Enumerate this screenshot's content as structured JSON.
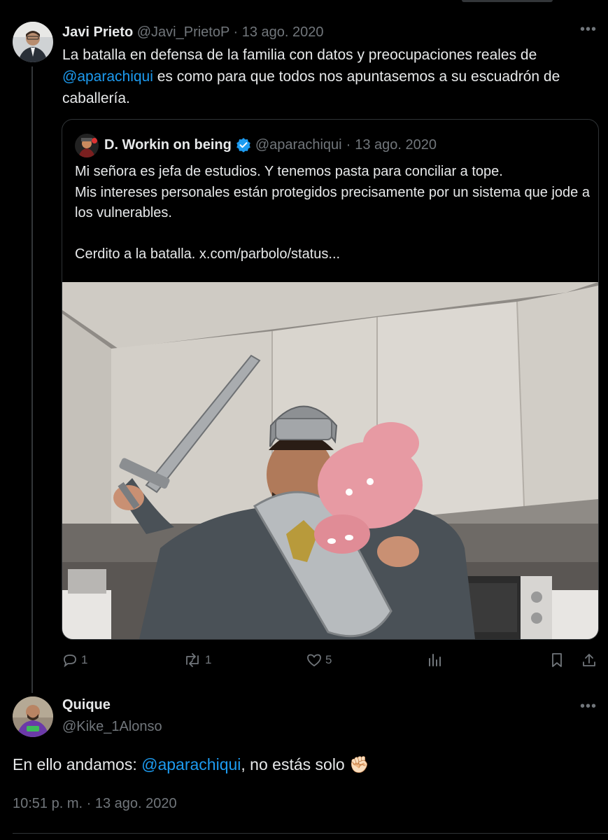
{
  "tweet1": {
    "author_name": "Javi Prieto",
    "author_handle": "@Javi_PrietoP",
    "sep": "·",
    "date": "13 ago. 2020",
    "text_before": "La batalla en defensa de la familia con datos y preocupaciones reales de ",
    "mention": "@aparachiqui",
    "text_after": " es como para que todos nos apuntasemos a su escuadrón de caballería."
  },
  "quote": {
    "author_name": "D. Workin on being",
    "author_handle": "@aparachiqui",
    "sep": "·",
    "date": "13 ago. 2020",
    "line1": "Mi señora es jefa de estudios. Y tenemos pasta para conciliar a tope.",
    "line2": "Mis intereses personales están protegidos precisamente por un sistema que jode a los vulnerables.",
    "line3": "Cerdito a la batalla.  x.com/parbolo/status..."
  },
  "actions": {
    "reply_count": "1",
    "retweet_count": "1",
    "like_count": "5"
  },
  "tweet2": {
    "author_name": "Quique",
    "author_handle": "@Kike_1Alonso",
    "text_before": "En ello andamos: ",
    "mention": "@aparachiqui",
    "text_after": ", no estás solo ",
    "emoji": "✊🏻",
    "time": "10:51 p. m.",
    "sep": "·",
    "date": "13 ago. 2020"
  },
  "icons": [
    "reply-icon",
    "retweet-icon",
    "like-icon",
    "views-icon",
    "bookmark-icon",
    "share-icon",
    "more-icon",
    "verified-icon"
  ]
}
